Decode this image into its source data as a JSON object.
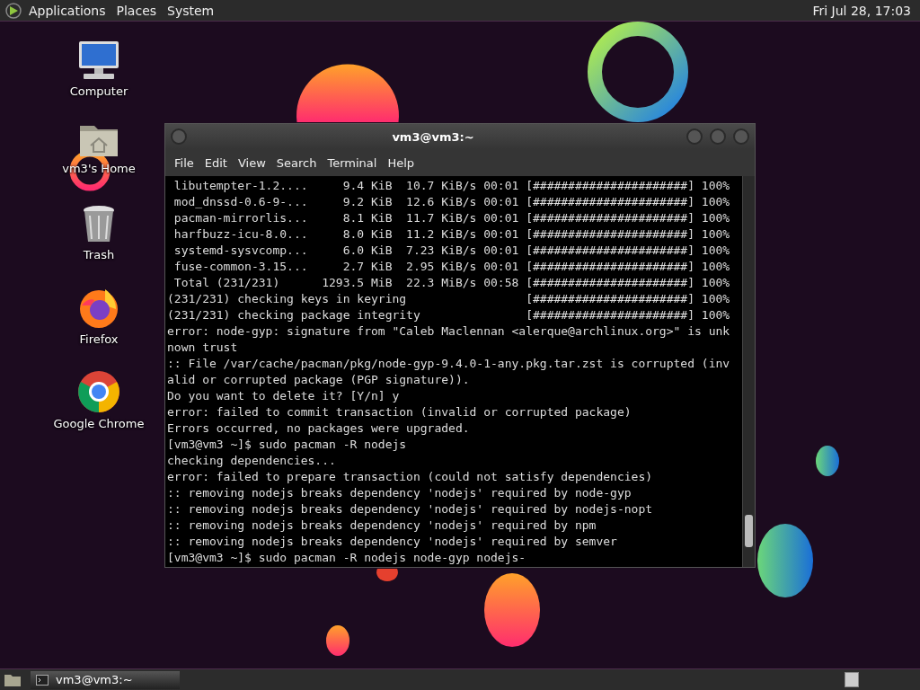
{
  "top_panel": {
    "menus": [
      "Applications",
      "Places",
      "System"
    ],
    "clock": "Fri Jul 28, 17:03"
  },
  "desktop_icons": [
    {
      "kind": "computer",
      "label": "Computer"
    },
    {
      "kind": "home",
      "label": "vm3's Home"
    },
    {
      "kind": "trash",
      "label": "Trash"
    },
    {
      "kind": "firefox",
      "label": "Firefox"
    },
    {
      "kind": "chrome",
      "label": "Google Chrome"
    }
  ],
  "terminal": {
    "title": "vm3@vm3:~",
    "menu": [
      "File",
      "Edit",
      "View",
      "Search",
      "Terminal",
      "Help"
    ],
    "lines": [
      " libutempter-1.2....     9.4 KiB  10.7 KiB/s 00:01 [######################] 100%",
      " mod_dnssd-0.6-9-...     9.2 KiB  12.6 KiB/s 00:01 [######################] 100%",
      " pacman-mirrorlis...     8.1 KiB  11.7 KiB/s 00:01 [######################] 100%",
      " harfbuzz-icu-8.0...     8.0 KiB  11.2 KiB/s 00:01 [######################] 100%",
      " systemd-sysvcomp...     6.0 KiB  7.23 KiB/s 00:01 [######################] 100%",
      " fuse-common-3.15...     2.7 KiB  2.95 KiB/s 00:01 [######################] 100%",
      " Total (231/231)      1293.5 MiB  22.3 MiB/s 00:58 [######################] 100%",
      "(231/231) checking keys in keyring                 [######################] 100%",
      "(231/231) checking package integrity               [######################] 100%",
      "error: node-gyp: signature from \"Caleb Maclennan <alerque@archlinux.org>\" is unk",
      "nown trust",
      ":: File /var/cache/pacman/pkg/node-gyp-9.4.0-1-any.pkg.tar.zst is corrupted (inv",
      "alid or corrupted package (PGP signature)).",
      "Do you want to delete it? [Y/n] y",
      "error: failed to commit transaction (invalid or corrupted package)",
      "Errors occurred, no packages were upgraded.",
      "[vm3@vm3 ~]$ sudo pacman -R nodejs",
      "checking dependencies...",
      "error: failed to prepare transaction (could not satisfy dependencies)",
      ":: removing nodejs breaks dependency 'nodejs' required by node-gyp",
      ":: removing nodejs breaks dependency 'nodejs' required by nodejs-nopt",
      ":: removing nodejs breaks dependency 'nodejs' required by npm",
      ":: removing nodejs breaks dependency 'nodejs' required by semver",
      "[vm3@vm3 ~]$ sudo pacman -R nodejs node-gyp nodejs-"
    ]
  },
  "taskbar": {
    "tasks": [
      {
        "label": "vm3@vm3:~",
        "selected": true
      }
    ]
  }
}
